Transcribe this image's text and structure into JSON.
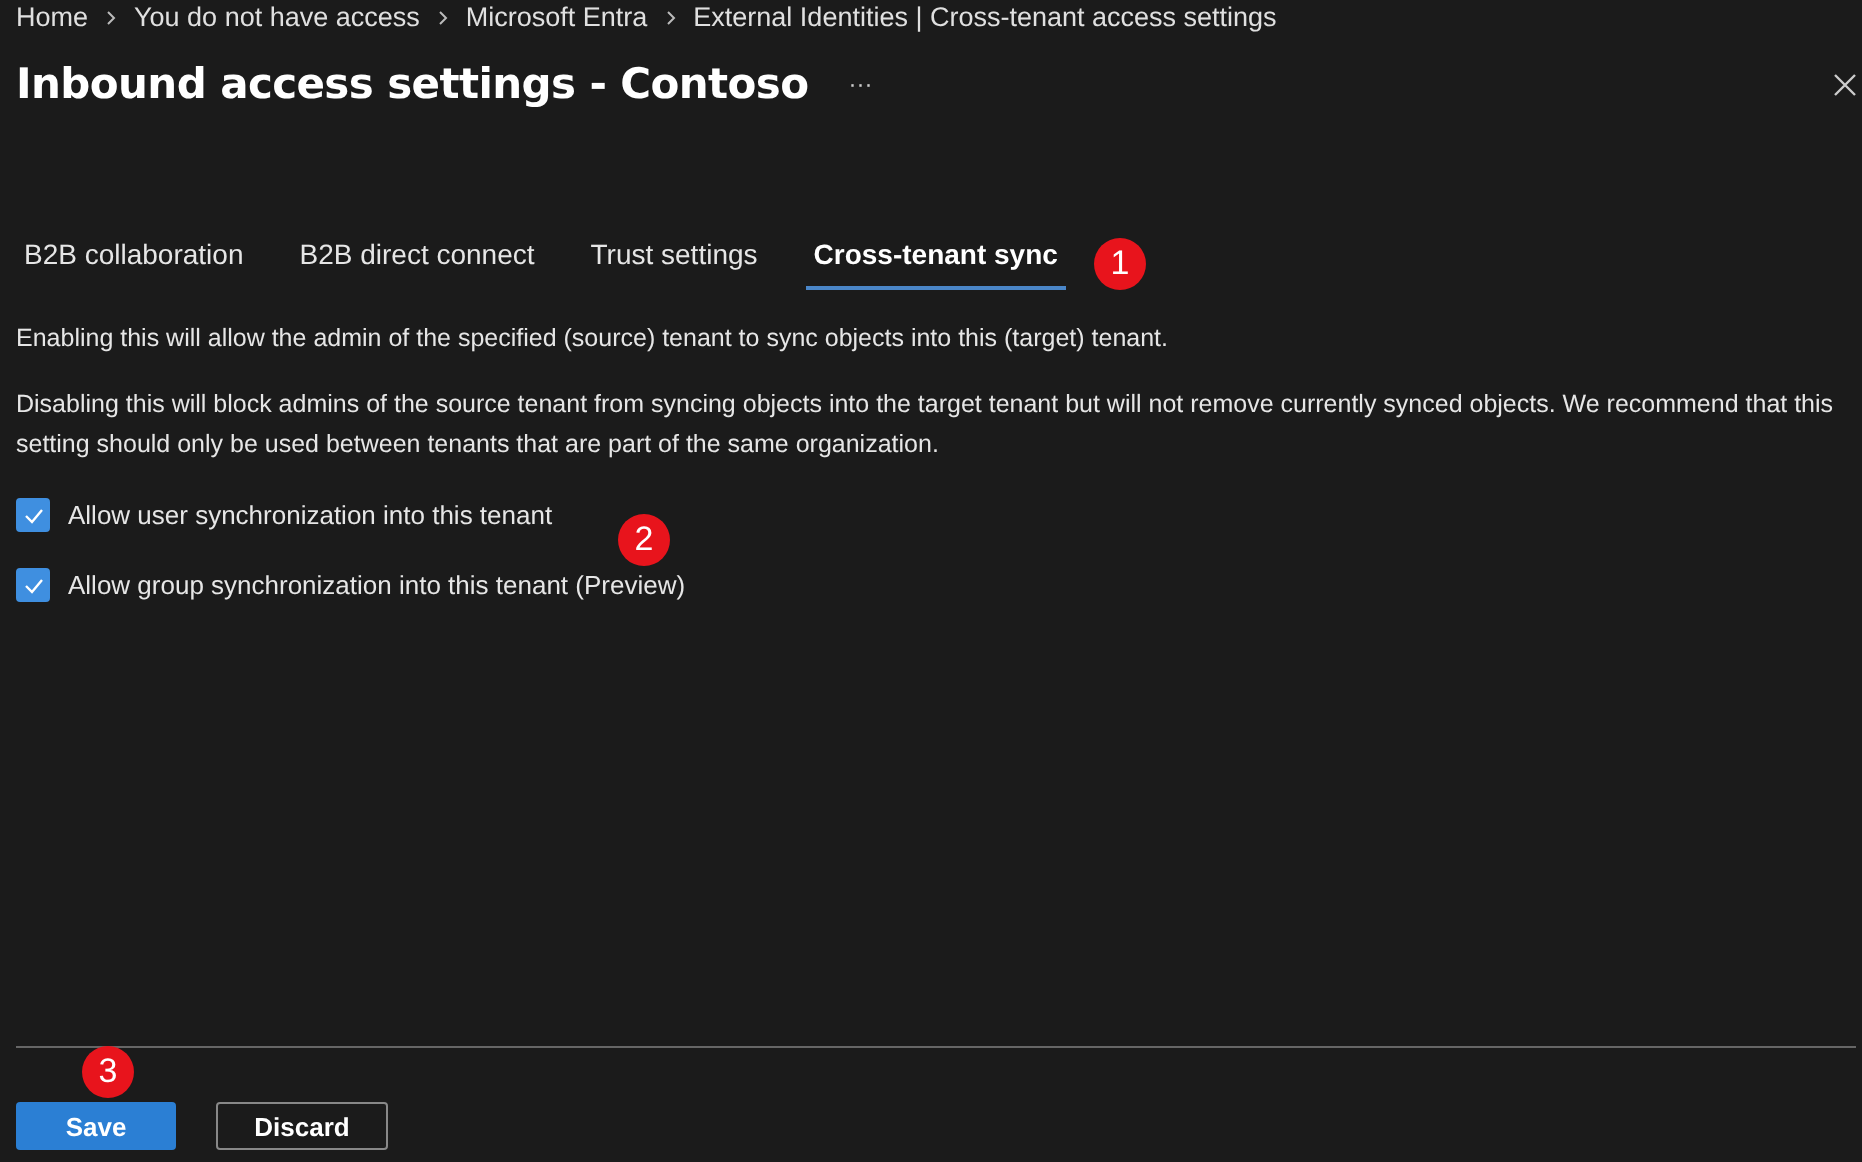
{
  "breadcrumb": [
    "Home",
    "You do not have access",
    "Microsoft Entra",
    "External Identities | Cross-tenant access settings"
  ],
  "title": "Inbound access settings - Contoso",
  "more": "···",
  "tabs": [
    {
      "label": "B2B collaboration",
      "selected": false
    },
    {
      "label": "B2B direct connect",
      "selected": false
    },
    {
      "label": "Trust settings",
      "selected": false
    },
    {
      "label": "Cross-tenant sync",
      "selected": true
    }
  ],
  "tabs_callout": "1",
  "paragraphs": [
    "Enabling this will allow the admin of the specified (source) tenant to sync objects into this (target) tenant.",
    "Disabling this will block admins of the source tenant from syncing objects into the target tenant but will not remove currently synced objects. We recommend that this setting should only be used between tenants that are part of the same organization."
  ],
  "checkboxes": [
    {
      "label": "Allow user synchronization into this tenant",
      "checked": true
    },
    {
      "label": "Allow group synchronization into this tenant (Preview)",
      "checked": true
    }
  ],
  "checkboxes_callout": "2",
  "buttons": [
    {
      "label": "Save",
      "kind": "primary"
    },
    {
      "label": "Discard",
      "kind": "secondary"
    }
  ],
  "footer_callout": "3"
}
